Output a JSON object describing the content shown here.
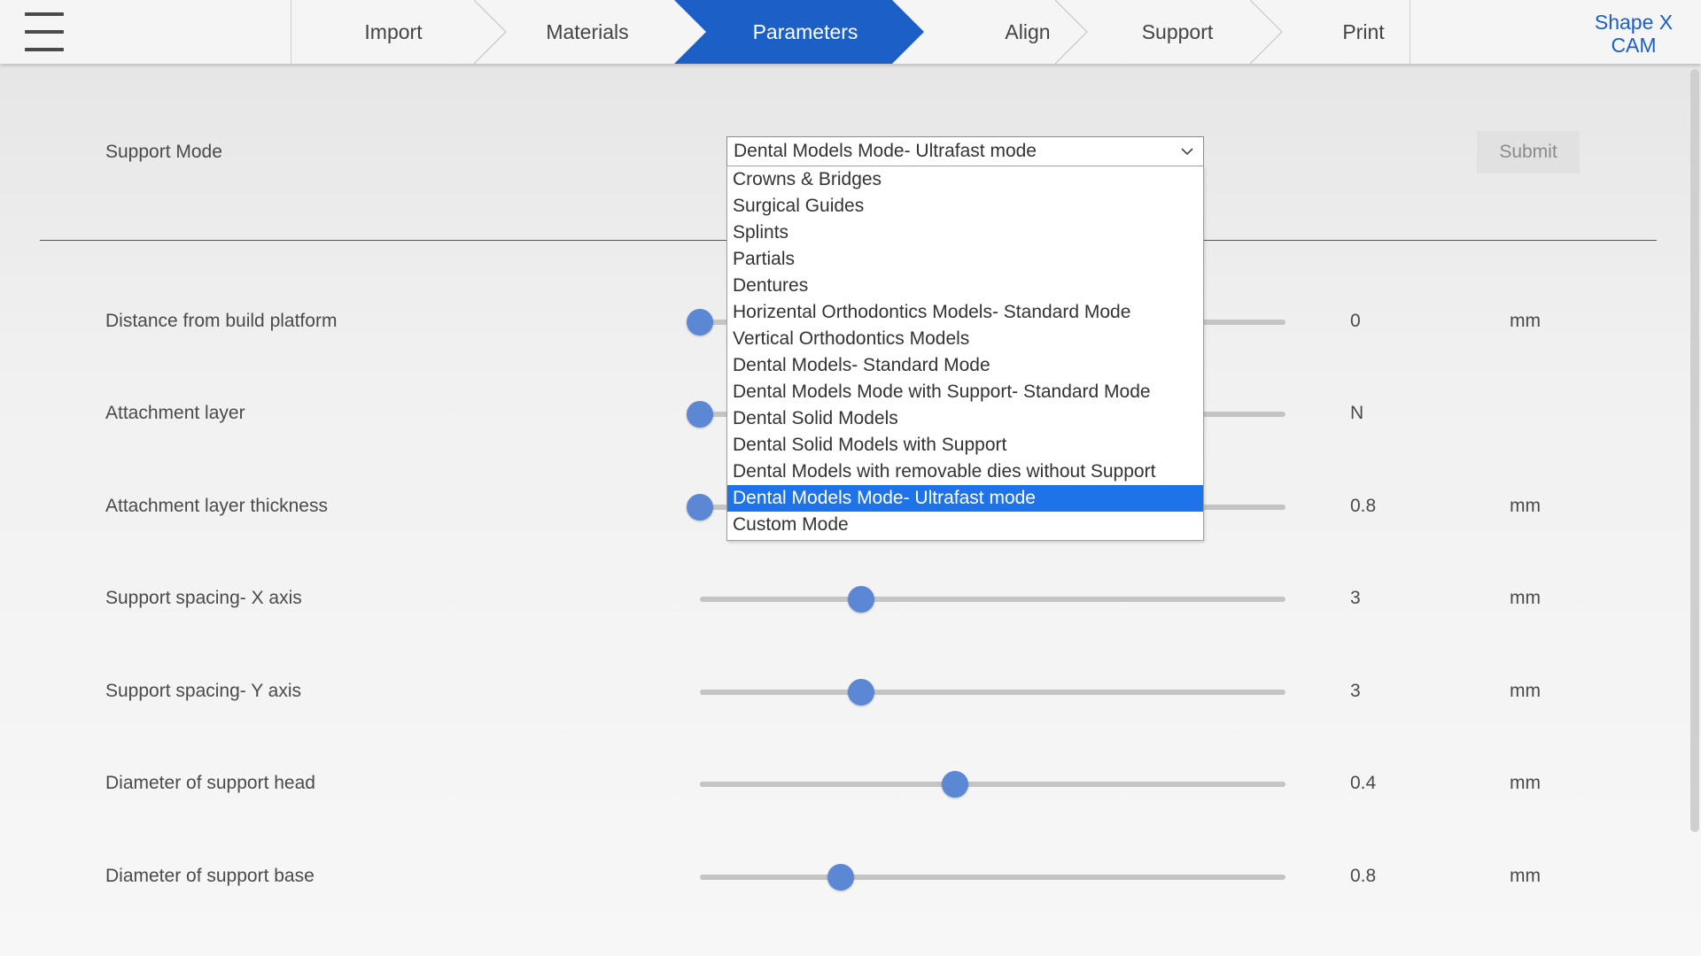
{
  "header": {
    "menu_icon": "hamburger-menu-icon",
    "steps": [
      {
        "label": "Import",
        "active": false
      },
      {
        "label": "Materials",
        "active": false
      },
      {
        "label": "Parameters",
        "active": true
      },
      {
        "label": "Align",
        "active": false
      },
      {
        "label": "Support",
        "active": false
      },
      {
        "label": "Print",
        "active": false
      }
    ],
    "brand_line1": "Shape X",
    "brand_line2": "CAM"
  },
  "colors": {
    "active_step": "#1b5fc7",
    "brand": "#1b5fc7",
    "slider_thumb": "#5b87d4",
    "selected_option": "#1e73e8"
  },
  "support_mode": {
    "label": "Support Mode",
    "selected": "Dental Models Mode- Ultrafast mode",
    "submit_label": "Submit",
    "options": [
      "Crowns & Bridges",
      "Surgical Guides",
      "Splints",
      "Partials",
      "Dentures",
      "Horizental Orthodontics Models- Standard Mode",
      "Vertical Orthodontics Models",
      "Dental Models- Standard Mode",
      "Dental Models Mode with Support- Standard Mode",
      "Dental Solid Models",
      "Dental Solid Models with Support",
      "Dental Models with removable dies without Support",
      "Dental Models Mode- Ultrafast mode",
      "Custom Mode"
    ],
    "selected_index": 12
  },
  "parameters": [
    {
      "label": "Distance from build platform",
      "value": "0",
      "unit": "mm",
      "fraction": 0.0
    },
    {
      "label": "Attachment layer",
      "value": "N",
      "unit": "",
      "fraction": 0.0
    },
    {
      "label": "Attachment layer thickness",
      "value": "0.8",
      "unit": "mm",
      "fraction": 0.0
    },
    {
      "label": "Support spacing- X axis",
      "value": "3",
      "unit": "mm",
      "fraction": 0.275
    },
    {
      "label": "Support spacing- Y axis",
      "value": "3",
      "unit": "mm",
      "fraction": 0.275
    },
    {
      "label": "Diameter of support head",
      "value": "0.4",
      "unit": "mm",
      "fraction": 0.435
    },
    {
      "label": "Diameter of support base",
      "value": "0.8",
      "unit": "mm",
      "fraction": 0.24
    }
  ]
}
